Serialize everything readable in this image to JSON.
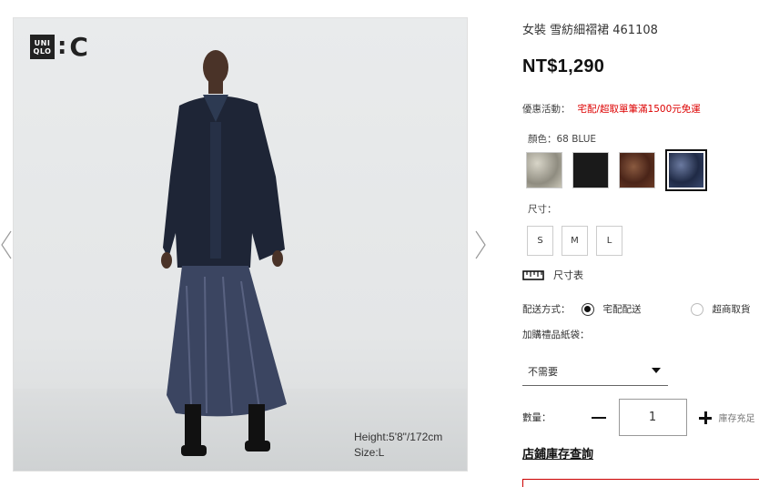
{
  "product_image": {
    "logo_top": "UNI",
    "logo_bottom": "QLO",
    "logo_colon": ":",
    "logo_letter": "C",
    "model_height": "Height:5'8\"/172cm",
    "model_size": "Size:L"
  },
  "product": {
    "title": "女裝 雪紡細褶裙 461108",
    "price": "NT$1,290"
  },
  "promo": {
    "label": "優惠活動：",
    "text": "宅配/超取單筆滿1500元免運"
  },
  "color": {
    "label": "顏色：68 BLUE",
    "swatch_colors": [
      "#b9b5a5",
      "#1a1a1a",
      "#5a2e1f",
      "#2c3a5c"
    ],
    "selected_index": 3
  },
  "size": {
    "label": "尺寸：",
    "options": [
      "S",
      "M",
      "L"
    ],
    "chart_label": "尺寸表"
  },
  "shipping": {
    "label": "配送方式：",
    "option_home": "宅配配送",
    "option_store": "超商取貨",
    "selected": "home"
  },
  "gift_bag": {
    "label": "加購禮品紙袋：",
    "selected_value": "不需要"
  },
  "quantity": {
    "label": "數量：",
    "value": "1",
    "stock_note": "庫存充足"
  },
  "store_stock_link": "店鋪庫存查詢",
  "colors": {
    "accent_red": "#d00000",
    "text": "#333333"
  }
}
